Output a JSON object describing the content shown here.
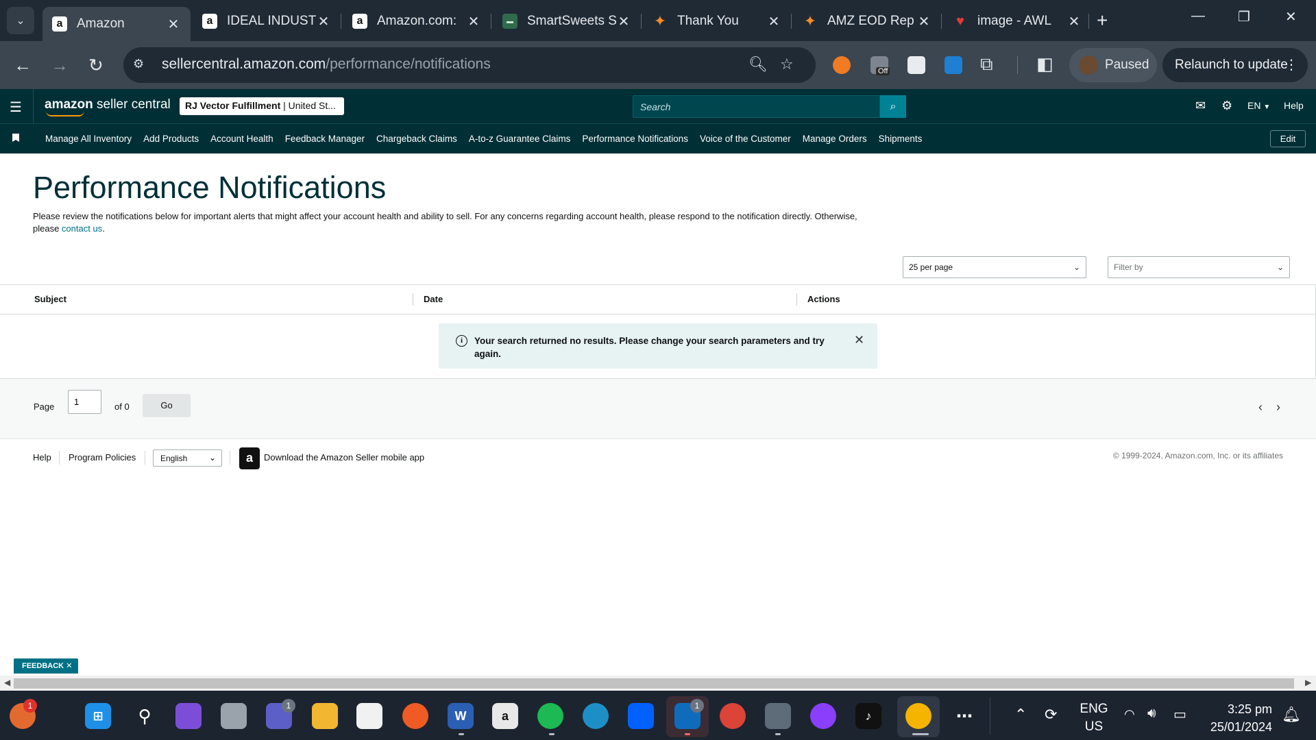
{
  "browser": {
    "tabs": [
      {
        "title": "Amazon",
        "favicon": "a",
        "active": true
      },
      {
        "title": "IDEAL INDUSTRIES",
        "favicon": "a",
        "active": false
      },
      {
        "title": "Amazon.com:",
        "favicon": "a",
        "active": false
      },
      {
        "title": "SmartSweets S",
        "favicon": "smartsweets",
        "active": false
      },
      {
        "title": "Thank You",
        "favicon": "feather-orange",
        "active": false
      },
      {
        "title": "AMZ EOD Rep",
        "favicon": "feather-orange",
        "active": false
      },
      {
        "title": "image - AWL",
        "favicon": "heart-red",
        "active": false
      }
    ],
    "url_host": "sellercentral.amazon.com",
    "url_path": "/performance/notifications",
    "profile_status": "Paused",
    "relaunch_label": "Relaunch to update",
    "extension_off_badge": "Off"
  },
  "seller_central": {
    "logo_bold": "amazon",
    "logo_rest": " seller central",
    "account_name": "RJ Vector Fulfillment",
    "account_region": " | United St...",
    "search_placeholder": "Search",
    "language": "EN",
    "help_label": "Help",
    "nav": [
      "Manage All Inventory",
      "Add Products",
      "Account Health",
      "Feedback Manager",
      "Chargeback Claims",
      "A-to-z Guarantee Claims",
      "Performance Notifications",
      "Voice of the Customer",
      "Manage Orders",
      "Shipments"
    ],
    "edit_label": "Edit"
  },
  "page": {
    "title": "Performance Notifications",
    "description": "Please review the notifications below for important alerts that might affect your account health and ability to sell. For any concerns regarding account health, please respond to the notification directly. Otherwise, please ",
    "contact_link": "contact us",
    "description_end": ".",
    "per_page_value": "25 per page",
    "filter_placeholder": "Filter by",
    "columns": [
      "Subject",
      "Date",
      "Actions"
    ],
    "alert_text": "Your search returned no results. Please change your search parameters and try again.",
    "pager": {
      "page_label": "Page",
      "page_value": "1",
      "of_label": "of 0",
      "go_label": "Go"
    }
  },
  "footer": {
    "help": "Help",
    "program_policies": "Program Policies",
    "language": "English",
    "download_app": "Download the Amazon Seller mobile app",
    "copyright": "© 1999-2024, Amazon.com, Inc. or its affiliates"
  },
  "feedback_label": "FEEDBACK",
  "taskbar": {
    "weather_badge": "1",
    "chat_badge": "1",
    "outlook_badge": "1",
    "lang_line1": "ENG",
    "lang_line2": "US",
    "time": "3:25 pm",
    "date": "25/01/2024"
  },
  "colors": {
    "header_bg": "#002f36",
    "search_button": "#008296",
    "link": "#007185",
    "alert_bg": "#e7f2f2",
    "browser_dark": "#1f2a35"
  }
}
